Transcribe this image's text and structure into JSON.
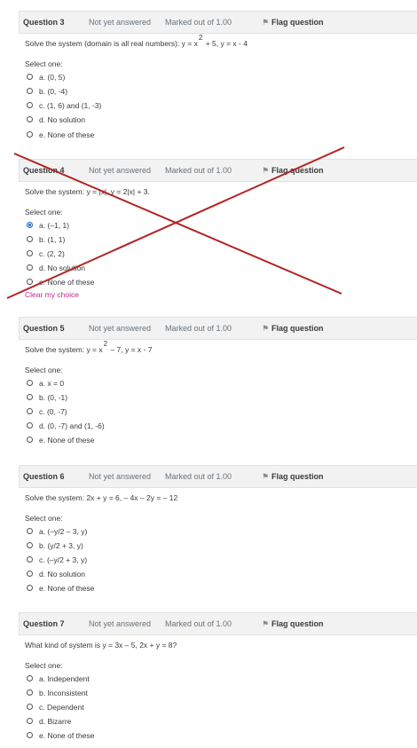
{
  "common": {
    "state": "Not yet answered",
    "marks": "Marked out of 1.00",
    "flag_label": "Flag question",
    "select_one": "Select one:"
  },
  "q3": {
    "number": "Question 3",
    "text_a": "Solve the system (domain is all real numbers): y = x",
    "sup": "2",
    "text_b": " + 5, y = x - 4",
    "options": [
      "a. (0, 5)",
      "b. (0, -4)",
      "c. (1, 6) and (1, -3)",
      "d. No solution",
      "e. None of these"
    ]
  },
  "q4": {
    "number": "Question 4",
    "text": "Solve the system: y = |x|, y = 2|x| + 3.",
    "options": [
      "a. (–1, 1)",
      "b. (1, 1)",
      "c. (2, 2)",
      "d. No solution",
      "e. None of these"
    ],
    "selected": "a",
    "clear_label": "Clear my choice"
  },
  "q5": {
    "number": "Question 5",
    "text_a": "Solve the system:  y = x",
    "sup": "2",
    "text_b": " – 7,  y =  x - 7",
    "options": [
      "a. x = 0",
      "b. (0, -1)",
      "c. (0, -7)",
      "d. (0, -7) and (1, -6)",
      "e. None of these"
    ]
  },
  "q6": {
    "number": "Question 6",
    "text": "Solve the system: 2x + y = 6, – 4x – 2y = – 12",
    "options": [
      "a. (–y/2 – 3, y)",
      "b. (y/2 + 3, y)",
      "c. (–y/2 + 3, y)",
      "d. No solution",
      "e. None of these"
    ]
  },
  "q7": {
    "number": "Question 7",
    "text": "What kind of system is y = 3x – 5, 2x + y = 8?",
    "options": [
      "a. Independent",
      "b. Inconsistent",
      "c. Dependent",
      "d. Bizarre",
      "e. None of these"
    ]
  },
  "colors": {
    "header_bg": "#f2f2f2",
    "link": "#c2278f",
    "radio_checked": "#0f6cbf",
    "cross_stroke": "#b22222"
  },
  "icons": {
    "flag": "flag-icon",
    "radio": "radio-button-icon"
  }
}
